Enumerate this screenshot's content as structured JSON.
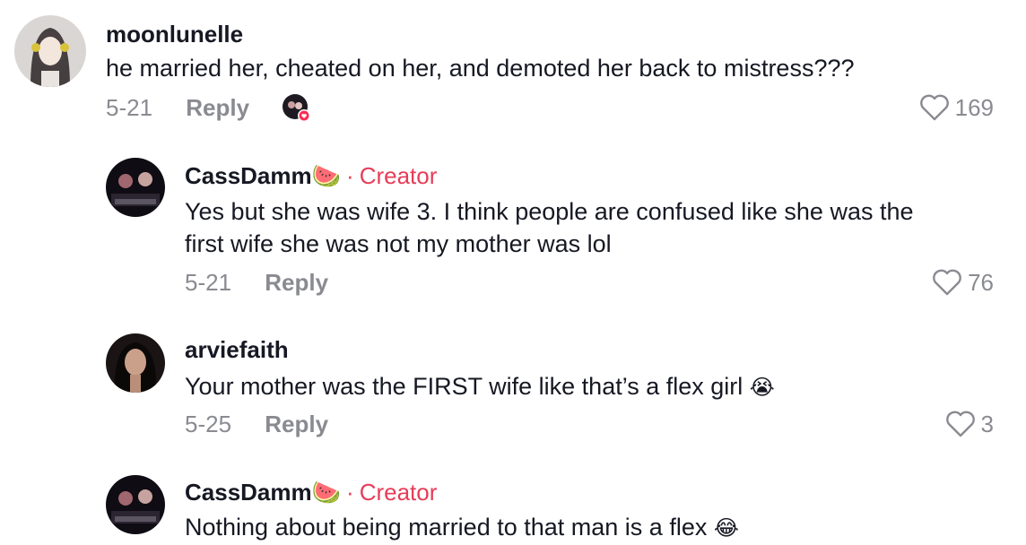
{
  "comments": [
    {
      "username": "moonlunelle",
      "text": "he married her, cheated on her, and demoted her back to mistress???",
      "date": "5-21",
      "reply_label": "Reply",
      "likes": "169",
      "creator_liked": true
    },
    {
      "username": "CassDamm",
      "username_emoji": "🍉",
      "badge_separator": "·",
      "badge": "Creator",
      "text_lines": [
        "Yes but she was wife 3. I think people are confused like she was the",
        "first wife she was not my mother was lol"
      ],
      "date": "5-21",
      "reply_label": "Reply",
      "likes": "76"
    },
    {
      "username": "arviefaith",
      "text": "Your mother was the FIRST wife like that’s a flex girl",
      "text_emoji": "😭",
      "date": "5-25",
      "reply_label": "Reply",
      "likes": "3"
    },
    {
      "username": "CassDamm",
      "username_emoji": "🍉",
      "badge_separator": "·",
      "badge": "Creator",
      "text": "Nothing about being married to that man is a flex",
      "text_emoji": "😂"
    }
  ],
  "colors": {
    "creator": "#e73d58",
    "muted": "#8a8b91",
    "text": "#161823"
  },
  "icons": [
    "heart-outline-icon",
    "creator-liked-badge-icon"
  ]
}
